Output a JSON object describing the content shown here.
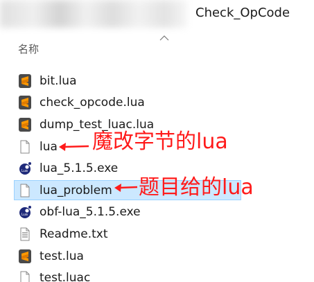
{
  "window": {
    "title": "Check_OpCode"
  },
  "header": {
    "name_column": "名称"
  },
  "files": [
    {
      "name": "bit.lua",
      "icon": "sublime-icon"
    },
    {
      "name": "check_opcode.lua",
      "icon": "sublime-icon"
    },
    {
      "name": "dump_test_luac.lua",
      "icon": "sublime-icon"
    },
    {
      "name": "lua",
      "icon": "blank-file-icon"
    },
    {
      "name": "lua_5.1.5.exe",
      "icon": "lua-exe-icon"
    },
    {
      "name": "lua_problem",
      "icon": "blank-file-icon",
      "selected": true
    },
    {
      "name": "obf-lua_5.1.5.exe",
      "icon": "lua-exe-icon"
    },
    {
      "name": "Readme.txt",
      "icon": "text-file-icon"
    },
    {
      "name": "test.lua",
      "icon": "sublime-icon"
    },
    {
      "name": "test.luac",
      "icon": "blank-file-icon"
    }
  ],
  "annotations": {
    "magic_lua": "魔改字节的lua",
    "problem_lua": "题目给的lua"
  },
  "colors": {
    "annotation": "#ff1a1a",
    "selection_bg": "#cce8ff",
    "selection_border": "#99d1ff",
    "sublime_orange": "#ff9800"
  }
}
